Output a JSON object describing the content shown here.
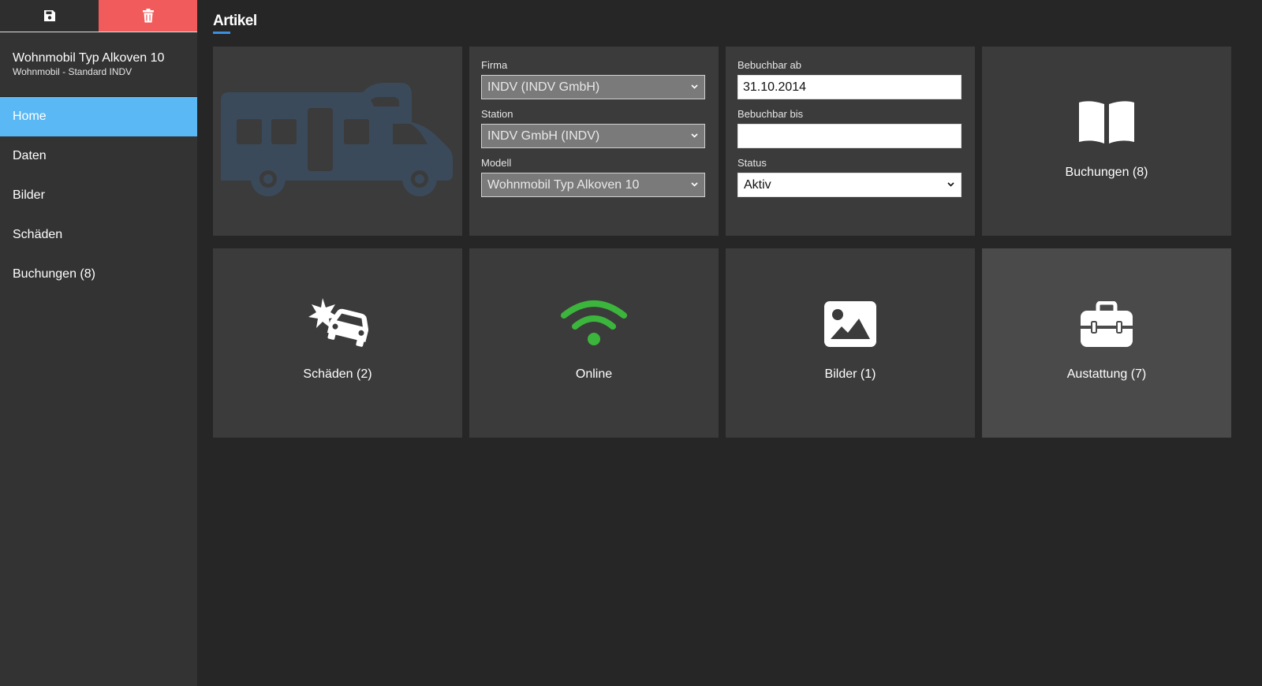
{
  "toolbar": {
    "save_icon": "floppy-disk-icon",
    "delete_icon": "trash-icon",
    "delete_color": "#f25b5b"
  },
  "item": {
    "title": "Wohnmobil Typ Alkoven 10",
    "subtitle": "Wohnmobil - Standard INDV"
  },
  "nav": {
    "active_color": "#5ab8f5",
    "items": [
      {
        "label": "Home"
      },
      {
        "label": "Daten"
      },
      {
        "label": "Bilder"
      },
      {
        "label": "Schäden"
      },
      {
        "label": "Buchungen (8)"
      }
    ]
  },
  "page": {
    "title": "Artikel"
  },
  "form": {
    "firma": {
      "label": "Firma",
      "value": "INDV (INDV GmbH)"
    },
    "station": {
      "label": "Station",
      "value": "INDV GmbH (INDV)"
    },
    "modell": {
      "label": "Modell",
      "value": "Wohnmobil Typ Alkoven 10"
    },
    "bebuchbar_ab": {
      "label": "Bebuchbar ab",
      "value": "31.10.2014"
    },
    "bebuchbar_bis": {
      "label": "Bebuchbar bis",
      "value": ""
    },
    "status": {
      "label": "Status",
      "value": "Aktiv"
    }
  },
  "tiles": {
    "vehicle_icon": "camper-van-icon",
    "buchungen": {
      "label": "Buchungen (8)",
      "icon": "open-book-icon"
    },
    "schaeden": {
      "label": "Schäden (2)",
      "icon": "car-crash-icon"
    },
    "online": {
      "label": "Online",
      "icon": "wifi-icon",
      "icon_color": "#3cb53c"
    },
    "bilder": {
      "label": "Bilder (1)",
      "icon": "image-icon"
    },
    "ausstattung": {
      "label": "Austattung (7)",
      "icon": "toolbox-icon"
    }
  }
}
